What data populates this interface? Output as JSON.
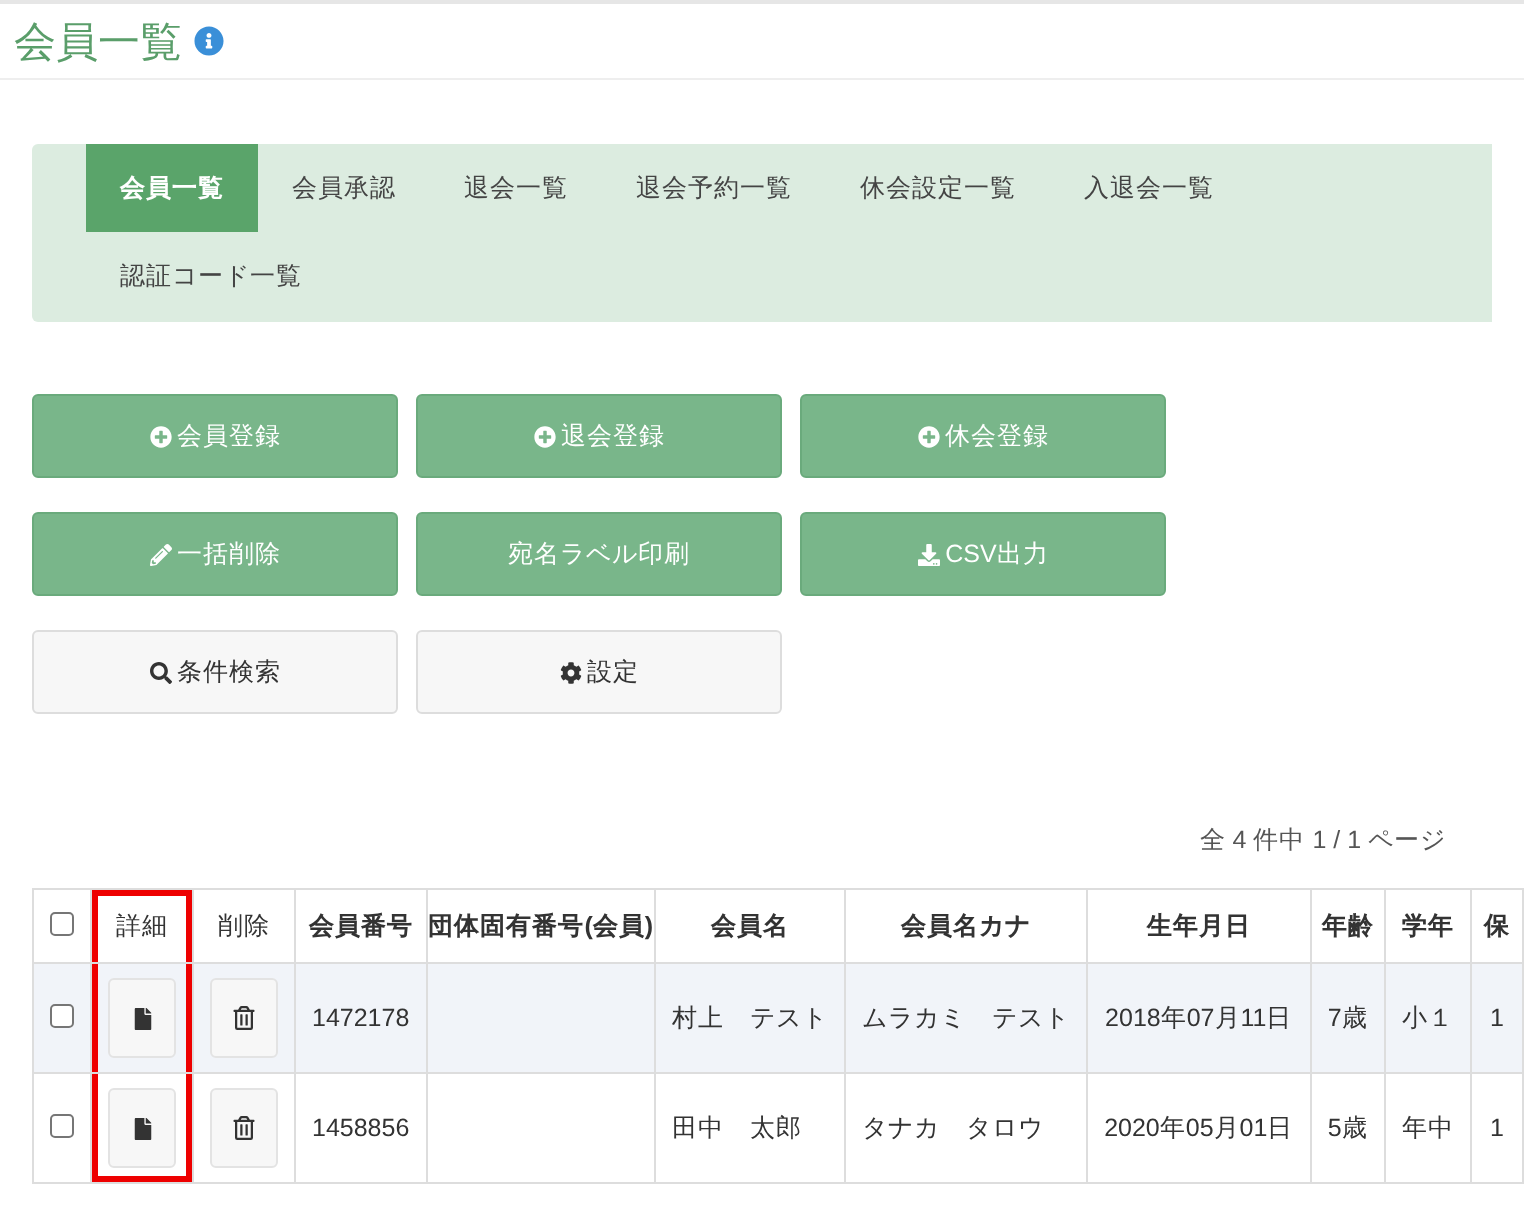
{
  "page_title": "会員一覧",
  "nav_tabs": [
    {
      "label": "会員一覧",
      "selected": true
    },
    {
      "label": "会員承認",
      "selected": false
    },
    {
      "label": "退会一覧",
      "selected": false
    },
    {
      "label": "退会予約一覧",
      "selected": false
    },
    {
      "label": "休会設定一覧",
      "selected": false
    },
    {
      "label": "入退会一覧",
      "selected": false
    },
    {
      "label": "認証コード一覧",
      "selected": false
    }
  ],
  "action_buttons": [
    {
      "label": "会員登録",
      "kind": "primary"
    },
    {
      "label": "退会登録",
      "kind": "primary"
    },
    {
      "label": "休会登録",
      "kind": "primary"
    },
    {
      "label": "一括削除",
      "kind": "primary"
    },
    {
      "label": "宛名ラベル印刷",
      "kind": "primary"
    },
    {
      "label": "CSV出力",
      "kind": "primary"
    },
    {
      "label": "条件検索",
      "kind": "default"
    },
    {
      "label": "設定",
      "kind": "default"
    }
  ],
  "pagination": "全 4 件中 1 / 1 ページ",
  "table": {
    "select_all_checked": false,
    "columns": [
      {
        "label": "詳細",
        "highlighted": true
      },
      {
        "label": "削除",
        "highlighted": false
      },
      {
        "label": "会員番号",
        "highlighted": false
      },
      {
        "label": "団体固有番号(会員)",
        "highlighted": false
      },
      {
        "label": "会員名",
        "highlighted": false
      },
      {
        "label": "会員名カナ",
        "highlighted": false
      },
      {
        "label": "生年月日",
        "highlighted": false
      },
      {
        "label": "年齢",
        "highlighted": false
      },
      {
        "label": "学年",
        "highlighted": false
      },
      {
        "label": "保",
        "highlighted": false
      }
    ],
    "rows": [
      {
        "checked": false,
        "member_no": "1472178",
        "name": "村上　テスト",
        "kana": "ムラカミ　テスト",
        "birth_date": "2018年07月11日",
        "age": "7歳",
        "grade": "小１",
        "column_11": "1"
      },
      {
        "checked": false,
        "member_no": "1458856",
        "name": "田中　太郎",
        "kana": "タナカ　タロウ",
        "birth_date": "2020年05月01日",
        "age": "5歳",
        "grade": "年中",
        "column_11": "1"
      }
    ]
  }
}
